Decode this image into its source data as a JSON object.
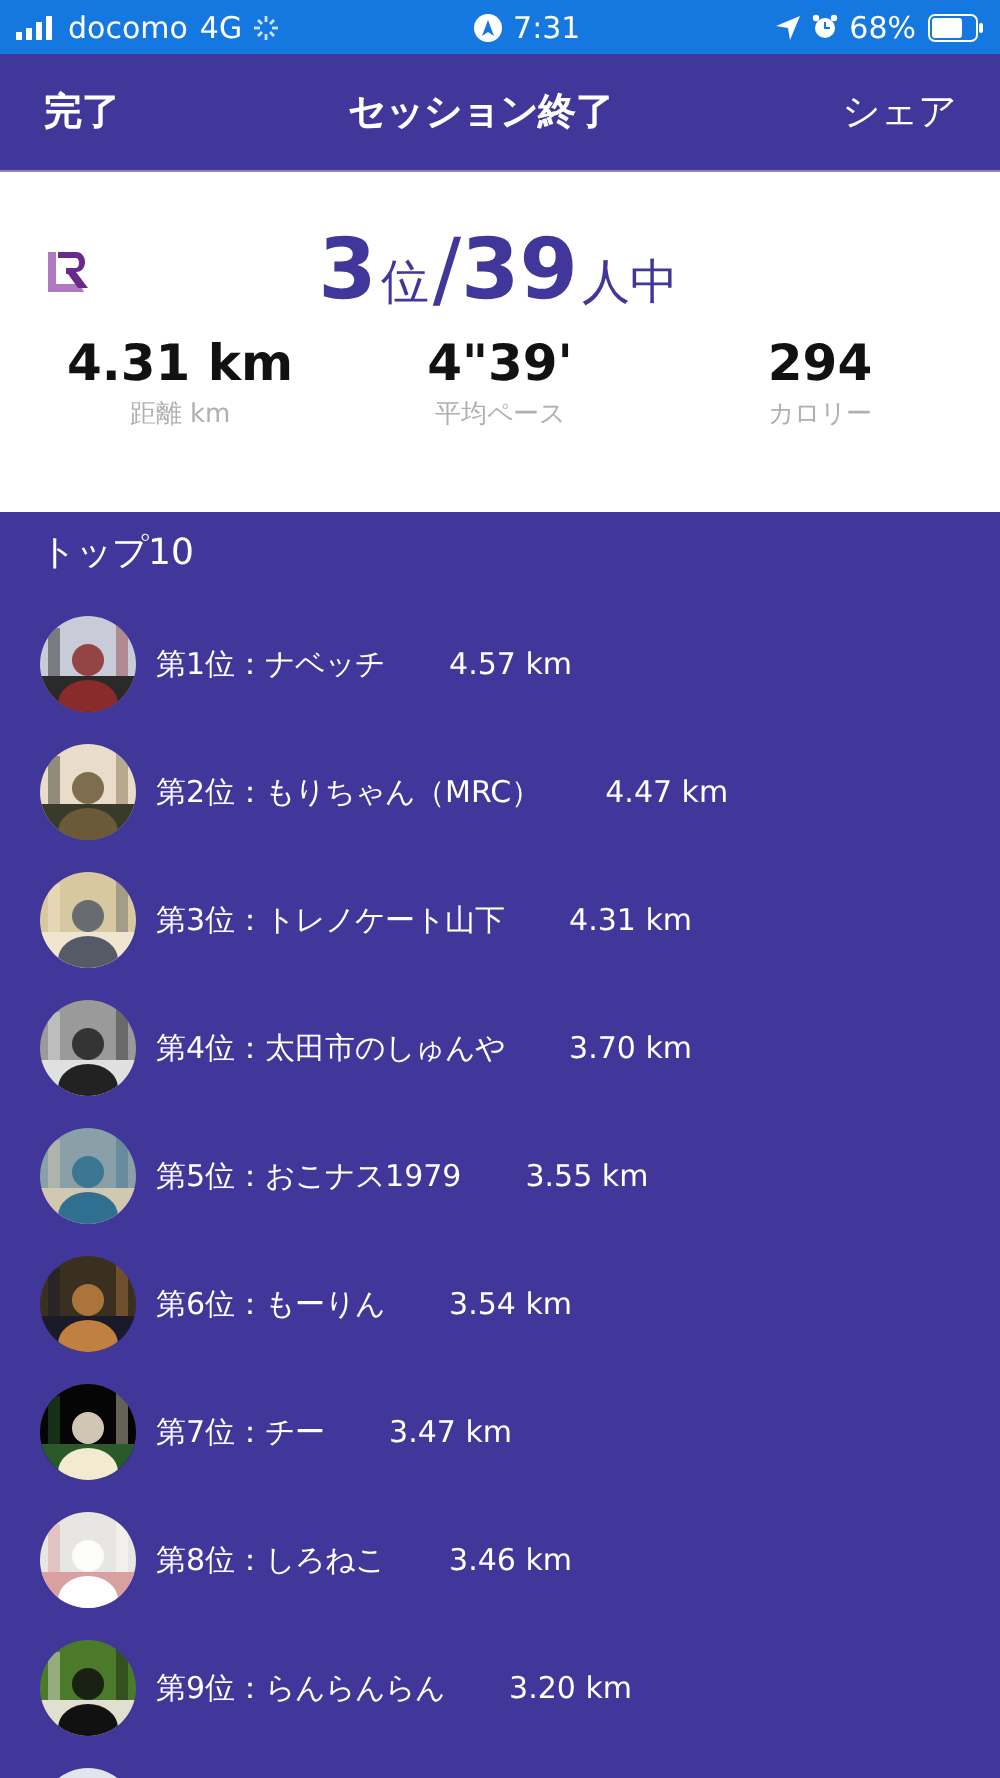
{
  "status_bar": {
    "carrier": "docomo",
    "network": "4G",
    "time": "7:31",
    "battery": "68%"
  },
  "nav": {
    "left": "完了",
    "title": "セッション終了",
    "right": "シェア"
  },
  "summary": {
    "rank": "3",
    "rank_unit": "位",
    "separator": "/",
    "total": "39",
    "total_unit": "人中",
    "stats": [
      {
        "value": "4.31 km",
        "label": "距離 km"
      },
      {
        "value": "4\"39'",
        "label": "平均ペース"
      },
      {
        "value": "294",
        "label": "カロリー"
      }
    ]
  },
  "ranking": {
    "title": "トップ10",
    "rows": [
      {
        "kind": "entry",
        "text": "第1位：ナベッチ",
        "distance": "4.57 km"
      },
      {
        "kind": "entry",
        "text": "第2位：もりちゃん（MRC）",
        "distance": "4.47 km"
      },
      {
        "kind": "entry",
        "text": "第3位：トレノケート山下",
        "distance": "4.31 km"
      },
      {
        "kind": "entry",
        "text": "第4位：太田市のしゅんや",
        "distance": "3.70 km"
      },
      {
        "kind": "entry",
        "text": "第5位：おこナス1979",
        "distance": "3.55 km"
      },
      {
        "kind": "entry",
        "text": "第6位：もーりん",
        "distance": "3.54 km"
      },
      {
        "kind": "entry",
        "text": "第7位：チー",
        "distance": "3.47 km"
      },
      {
        "kind": "entry",
        "text": "第8位：しろねこ",
        "distance": "3.46 km"
      },
      {
        "kind": "entry",
        "text": "第9位：らんらんらん",
        "distance": "3.20 km"
      },
      {
        "kind": "picture"
      }
    ]
  }
}
